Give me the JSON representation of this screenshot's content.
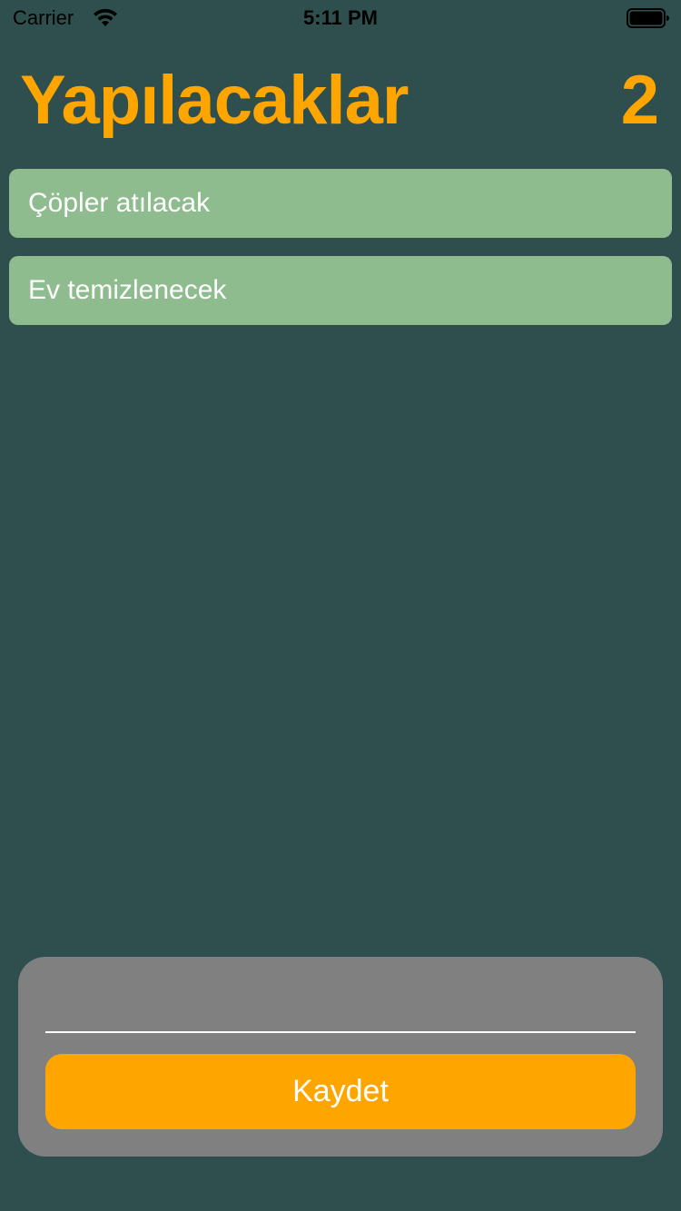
{
  "status_bar": {
    "carrier": "Carrier",
    "time": "5:11 PM",
    "icons": [
      "wifi-icon",
      "battery-icon"
    ]
  },
  "header": {
    "title": "Yapılacaklar",
    "count": "2"
  },
  "todos": [
    {
      "label": "Çöpler atılacak"
    },
    {
      "label": "Ev temizlenecek"
    }
  ],
  "input": {
    "value": "",
    "placeholder": ""
  },
  "save_button": {
    "label": "Kaydet"
  },
  "colors": {
    "background": "#2f4f4f",
    "accent": "#ffa500",
    "todo_item": "#8fbc8f",
    "panel": "#808080",
    "text_on_accent": "#ffffff"
  }
}
